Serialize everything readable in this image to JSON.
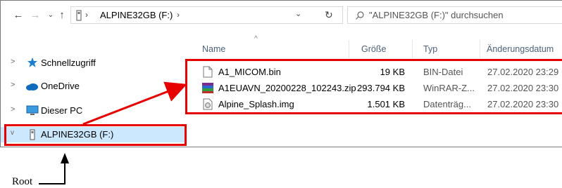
{
  "address": {
    "segments": [
      "ALPINE32GB (F:)"
    ],
    "search_placeholder": "\"ALPINE32GB (F:)\" durchsuchen"
  },
  "columns": [
    "Name",
    "Größe",
    "Typ",
    "Änderungsdatum"
  ],
  "nav": {
    "items": [
      {
        "label": "Schnellzugriff",
        "icon": "star-icon"
      },
      {
        "label": "OneDrive",
        "icon": "cloud-icon"
      },
      {
        "label": "Dieser PC",
        "icon": "monitor-icon"
      },
      {
        "label": "ALPINE32GB (F:)",
        "icon": "usb-drive-icon",
        "selected": true
      }
    ]
  },
  "files": [
    {
      "name": "A1_MICOM.bin",
      "size": "19 KB",
      "type": "BIN-Datei",
      "date": "27.02.2020 23:29",
      "icon": "file-icon"
    },
    {
      "name": "A1EUAVN_20200228_102243.zip",
      "size": "293.794 KB",
      "type": "WinRAR-Z...",
      "date": "27.02.2020 23:30",
      "icon": "winrar-archive-icon"
    },
    {
      "name": "Alpine_Splash.img",
      "size": "1.501 KB",
      "type": "Datenträg...",
      "date": "27.02.2020 23:30",
      "icon": "disk-image-icon"
    }
  ],
  "annotation": {
    "label": "Root"
  },
  "colors": {
    "highlight_box": "#e60000",
    "selection": "#cce8ff"
  }
}
